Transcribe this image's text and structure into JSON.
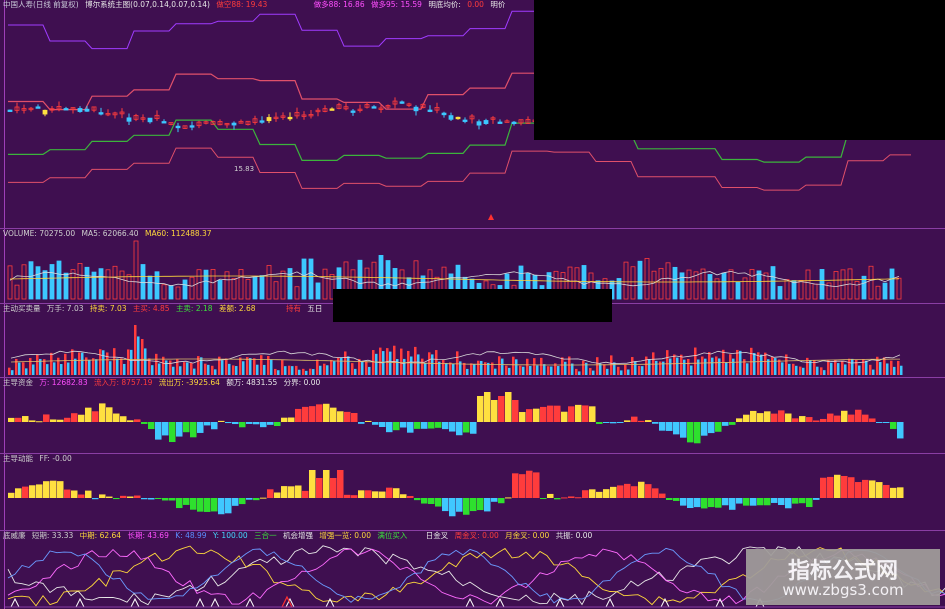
{
  "colors": {
    "background": "#3f0f50",
    "up": "#ff3c3c",
    "down": "#3cc8ff",
    "yellow": "#ffe040",
    "green": "#2ee02e",
    "band_upper": "#a03cff",
    "band_red": "#e0506a",
    "band_green": "#3cb43c"
  },
  "main": {
    "header": {
      "title": "中国人寿(日线 前复权)",
      "indicator": "博尔系统主图(0.07,0.14,0.07,0.14)",
      "item1": "做空88: 19.43",
      "item2": "做多88: 16.86",
      "item3": "做多95: 15.59",
      "item4": "明底均价:",
      "item5": "0.00",
      "item6": "明价"
    },
    "low_price_label": "15.83"
  },
  "volume": {
    "header": {
      "name": "VOLUME: 70275.00",
      "ma5": "MA5: 62066.40",
      "ma60": "MA60: 112488.37"
    }
  },
  "trade": {
    "header": {
      "name": "主动买卖量",
      "wan": "万手: 7.03",
      "hold": "持卖: 7.03",
      "buy": "主买: 4.85",
      "sell": "主卖: 2.18",
      "ratio": "差额: 2.68",
      "extra1": "持有",
      "extra2": "五日"
    }
  },
  "capital": {
    "header": {
      "name": "主导资金",
      "wan": "万: 12682.83",
      "inflow": "流入万: 8757.19",
      "outflow": "流出万: -3925.64",
      "amount": "额万: 4831.55",
      "share": "分界: 0.00"
    }
  },
  "momentum": {
    "header": {
      "name": "主导动能",
      "ff": "FF: -0.00"
    }
  },
  "kdj": {
    "header": {
      "name": "底威廉",
      "short": "短期: 33.33",
      "mid": "中期: 62.64",
      "long": "长期: 43.69",
      "k": "K: 48.99",
      "y": "Y: 100.00",
      "sanhe": "三合一",
      "jihui": "机会增强",
      "zengqiang": "增强一览: 0.00",
      "buy": "满位买入",
      "r1": "日金叉",
      "r2": "周金叉: 0.00",
      "r3": "月金叉: 0.00",
      "r4": "共振: 0.00"
    }
  },
  "watermark": {
    "title": "指标公式网",
    "url": "www.zbgs3.com"
  }
}
